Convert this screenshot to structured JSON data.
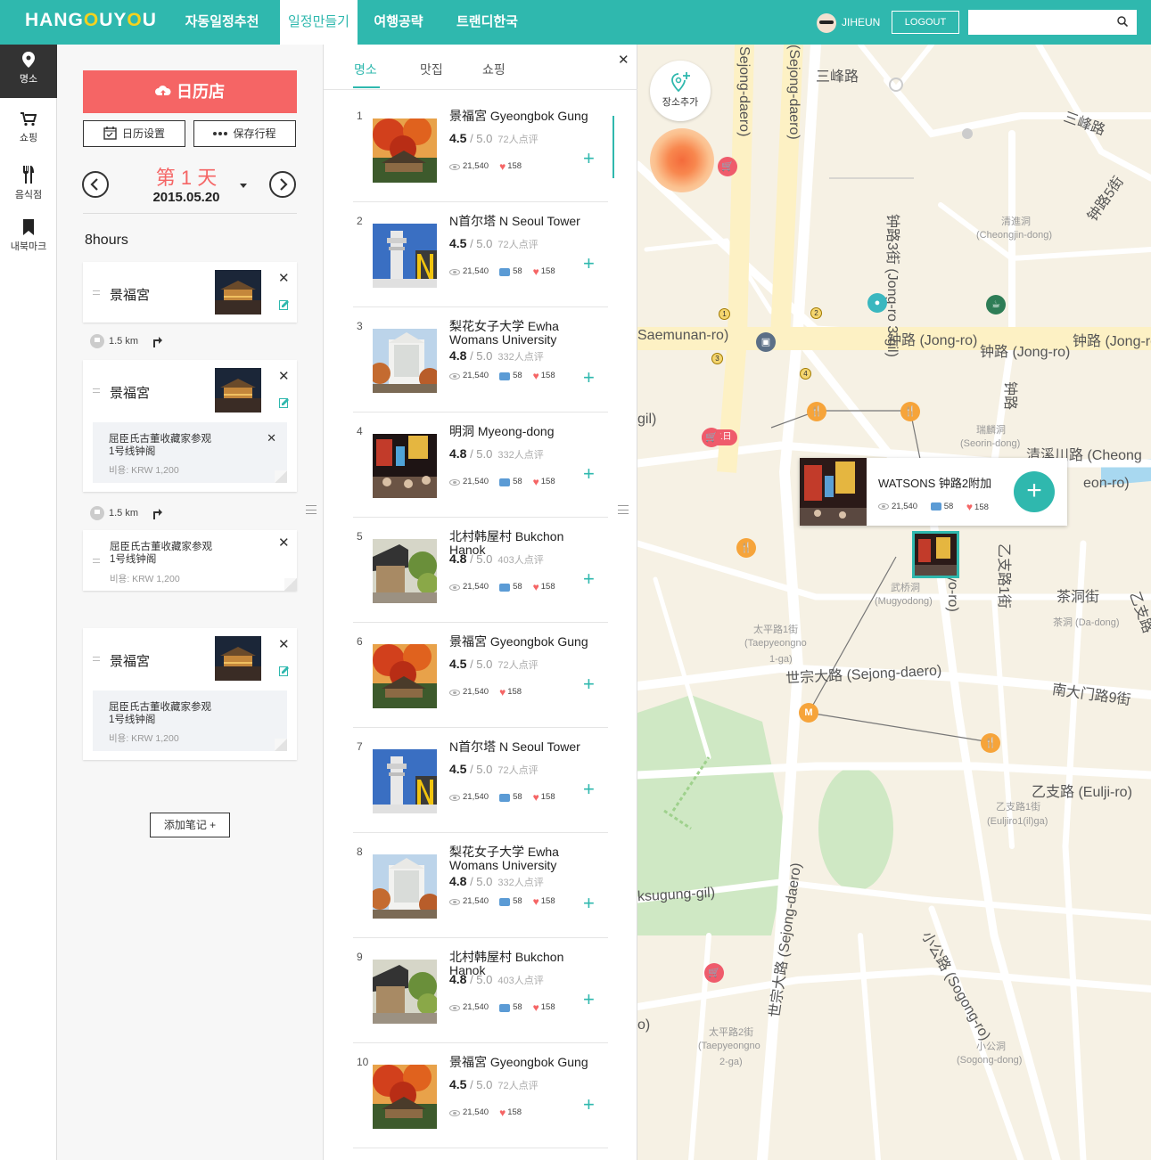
{
  "header": {
    "logo_pre": "HANG",
    "logo_o1": "O",
    "logo_mid": "UY",
    "logo_o2": "O",
    "logo_post": "U",
    "nav": [
      "자동일정추천",
      "일정만들기",
      "여행공략",
      "트랜디한국"
    ],
    "active_nav": 1,
    "user": "JIHEUN",
    "logout": "LOGOUT",
    "search_placeholder": ""
  },
  "sidebar": {
    "items": [
      {
        "label": "명소",
        "icon": "location-pin-icon",
        "active": true
      },
      {
        "label": "쇼핑",
        "icon": "shopping-cart-icon",
        "active": false
      },
      {
        "label": "음식점",
        "icon": "fork-knife-icon",
        "active": false
      },
      {
        "label": "내북마크",
        "icon": "bookmark-icon",
        "active": false
      }
    ]
  },
  "schedule": {
    "calendar_button": "日历店",
    "settings_button": "日历设置",
    "save_button": "保存行程",
    "day_label": "第 1 天",
    "day_date": "2015.05.20",
    "duration": "8hours",
    "cards": [
      {
        "name": "景福宮"
      },
      {
        "name": "景福宮",
        "note": "屈臣氏古董收藏家参观\n1号线钟阁",
        "cost": "비용: KRW 1,200"
      },
      {
        "note_only": true,
        "note": "屈臣氏古董收藏家参观\n1号线钟阁",
        "cost": "비용: KRW 1,200"
      },
      {
        "name": "景福宮",
        "note": "屈臣氏古董收藏家参观\n1号线钟阁",
        "cost": "비용: KRW 1,200"
      }
    ],
    "routes": [
      {
        "distance": "1.5 km"
      },
      {
        "distance": "1.5 km"
      }
    ],
    "add_note": "添加笔记 +"
  },
  "list": {
    "tabs": [
      "명소",
      "맛집",
      "쇼핑"
    ],
    "active_tab": 0,
    "items": [
      {
        "num": "1",
        "name": "景福宮 Gyeongbok Gung",
        "rating": "4.5",
        "max": " / 5.0",
        "reviews": "72人点评",
        "views": "21,540",
        "comments": "",
        "likes": "158",
        "thumb": "autumn"
      },
      {
        "num": "2",
        "name": "N首尔塔  N Seoul Tower",
        "rating": "4.5",
        "max": " / 5.0",
        "reviews": "72人点评",
        "views": "21,540",
        "comments": "58",
        "likes": "158",
        "thumb": "tower"
      },
      {
        "num": "3",
        "name": "梨花女子大学  Ewha Womans University",
        "rating": "4.8",
        "max": " / 5.0",
        "reviews": "332人点评",
        "views": "21,540",
        "comments": "58",
        "likes": "158",
        "thumb": "univ"
      },
      {
        "num": "4",
        "name": "明洞  Myeong-dong",
        "rating": "4.8",
        "max": " / 5.0",
        "reviews": "332人点评",
        "views": "21,540",
        "comments": "58",
        "likes": "158",
        "thumb": "street"
      },
      {
        "num": "5",
        "name": "北村韩屋村 Bukchon Hanok",
        "rating": "4.8",
        "max": " / 5.0",
        "reviews": "403人点评",
        "views": "21,540",
        "comments": "58",
        "likes": "158",
        "thumb": "hanok"
      },
      {
        "num": "6",
        "name": "景福宮 Gyeongbok Gung",
        "rating": "4.5",
        "max": " / 5.0",
        "reviews": "72人点评",
        "views": "21,540",
        "comments": "",
        "likes": "158",
        "thumb": "autumn"
      },
      {
        "num": "7",
        "name": "N首尔塔  N Seoul Tower",
        "rating": "4.5",
        "max": " / 5.0",
        "reviews": "72人点评",
        "views": "21,540",
        "comments": "58",
        "likes": "158",
        "thumb": "tower"
      },
      {
        "num": "8",
        "name": "梨花女子大学  Ewha Womans University",
        "rating": "4.8",
        "max": " / 5.0",
        "reviews": "332人点评",
        "views": "21,540",
        "comments": "58",
        "likes": "158",
        "thumb": "univ"
      },
      {
        "num": "9",
        "name": "北村韩屋村 Bukchon Hanok",
        "rating": "4.8",
        "max": " / 5.0",
        "reviews": "403人点评",
        "views": "21,540",
        "comments": "58",
        "likes": "158",
        "thumb": "hanok"
      },
      {
        "num": "10",
        "name": "景福宮 Gyeongbok Gung",
        "rating": "4.5",
        "max": " / 5.0",
        "reviews": "72人点评",
        "views": "21,540",
        "comments": "",
        "likes": "158",
        "thumb": "autumn"
      }
    ]
  },
  "map": {
    "add_place": "장소추가",
    "day_tag": "1日",
    "popup": {
      "name": "WATSONS 钟路2附加",
      "views": "21,540",
      "comments": "58",
      "likes": "158"
    },
    "labels": [
      "三峰路",
      "三峰路",
      "钟路5街",
      "钟路3街 (Jong-ro 3-gil)",
      "清進洞",
      "(Cheongjin-dong)",
      "Saemunan-ro)",
      "钟路 (Jong-ro)",
      "钟路 (Jong-ro)",
      "钟路 (Jong-ro",
      "钟路",
      "瑞麟洞",
      "(Seorin-dong)",
      "清溪川路 (Cheong",
      "eon-ro)",
      "武桥洞",
      "(Mugyodong)",
      "乙支路1街",
      "茶洞街",
      "茶洞 (Da-dong)",
      "乙支路",
      "太平路1街",
      "(Taepyeongno",
      "1-ga)",
      "世宗大路 (Sejong-daero)",
      "南大门路9街",
      "乙支路 (Eulji-ro)",
      "乙支路1街",
      "(Euljiro1(il)ga)",
      "ksugung-gil)",
      "世宗大路 (Sejong-daero)",
      "小公路 (Sogong-ro)",
      "太平路2街",
      "(Taepyeongno",
      "2-ga)",
      "小公洞",
      "(Sogong-dong)",
      "Sejong-daero)",
      "(Sejong-daero)",
      "gil)",
      "yo-ro)",
      "o)"
    ]
  },
  "colors": {
    "brand": "#2fb8ae",
    "accent": "#f56565",
    "map_bg": "#f6f1e4",
    "road": "#ffffff",
    "major_road": "#fdf1c4"
  }
}
